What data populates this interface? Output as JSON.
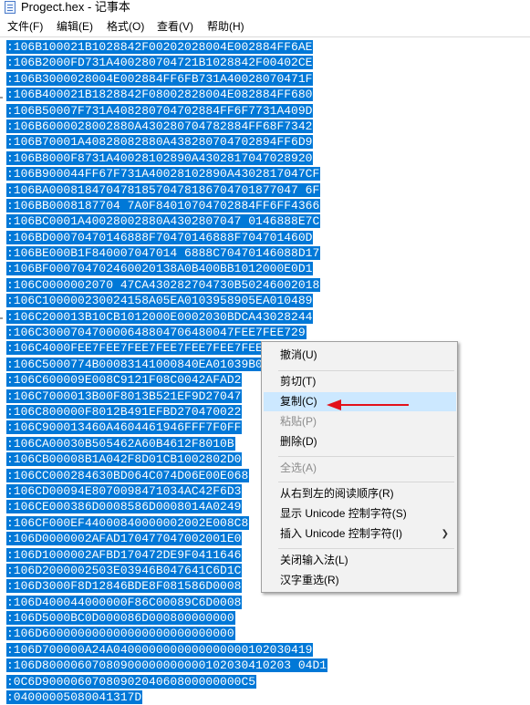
{
  "window": {
    "title": "Progect.hex - 记事本"
  },
  "menubar": [
    {
      "label": "文件(F)"
    },
    {
      "label": "编辑(E)"
    },
    {
      "label": "格式(O)"
    },
    {
      "label": "查看(V)"
    },
    {
      "label": "帮助(H)"
    }
  ],
  "editor": {
    "lines": [
      ":106B100021B1028842F00202028004E002884FF6AE",
      ":106B2000FD731A400280704721B1028842F00402CE",
      ":106B3000028004E002884FF6FB731A40028070471F",
      ":106B400021B1828842F08002828004E082884FF680",
      ":106B50007F731A408280704702884FF6F7731A409D",
      ":106B6000028002880A430280704782884FF68F7342",
      ":106B70001A40828082880A438280704702894FF6D9",
      ":106B8000F8731A40028102890A4302817047028920",
      ":106B900044FF67F731A40028102890A4302817047CF",
      ":106BA00081847047818570478186704701877047 6F",
      ":106BB0008187704 7A0F84010704702884FF6FF4366",
      ":106BC0001A40028002880A4302807047 0146888E7C",
      ":106BD00070470146888F70470146888F704701460D",
      ":106BE000B1F840007047014 6888C70470146088D17",
      ":106BF000704702460020138A0B400BB1012000E0D1",
      ":106C0000002070 47CA430282704730B50246002018",
      ":106C100000230024158A05EA0103958905EA010489",
      ":106C200013B10CB1012000E0002030BDCA43028244",
      ":106C300070470000648804706480047FEE7FEE729",
      ":106C4000FEE7FEE7FEE7FEE7FEE7FEE7FEE7FEE71C",
      ":106C5000774B00083141000840EA01039B0703D04D",
      ":106C600009E008C9121F08C0042AFAD2",
      ":106C7000013B00F8013B521EF9D27047",
      ":106C800000F8012B491EFBD270470022",
      ":106C900013460A4604461946FFF7F0FF",
      ":106CA00030B505462A60B4612F8010B",
      ":106CB00008B1A042F8D01CB1002802D0",
      ":106CC000284630BD064C074D06E00E068",
      ":106CD00094E8070098471034AC42F6D3",
      ":106CE000386D0008586D0008014A0249",
      ":106CF000EF44000840000002002E008C8",
      ":106D0000002AFAD170477047002001E0",
      ":106D1000002AFBD170472DE9F0411646",
      ":106D2000002503E03946B047641C6D1C",
      ":106D3000F8D12846BDE8F081586D0008",
      ":106D400044000000F86C00089C6D0008",
      ":106D5000BC0D000086D000800000000",
      ":106D600000000000000000000000000",
      ":106D700000A24A0400000000000000000102030419",
      ":106D80000607080900000000000102030410203 04D1",
      ":0C6D9000060708090204060800000000C5",
      ":04000005080041317D"
    ]
  },
  "context_menu": {
    "items": [
      {
        "label": "撤消(U)",
        "enabled": true
      },
      {
        "label": "剪切(T)",
        "enabled": true
      },
      {
        "label": "复制(C)",
        "enabled": true,
        "highlighted": true
      },
      {
        "label": "粘贴(P)",
        "enabled": false
      },
      {
        "label": "删除(D)",
        "enabled": true
      },
      {
        "label": "全选(A)",
        "enabled": false
      },
      {
        "label": "从右到左的阅读顺序(R)",
        "enabled": true
      },
      {
        "label": "显示 Unicode 控制字符(S)",
        "enabled": true
      },
      {
        "label": "插入 Unicode 控制字符(I)",
        "enabled": true,
        "submenu": true
      },
      {
        "label": "关闭输入法(L)",
        "enabled": true
      },
      {
        "label": "汉字重选(R)",
        "enabled": true
      }
    ]
  },
  "colors": {
    "selection": "#0078d7",
    "menu_highlight": "#cce8ff",
    "annotation_arrow": "#e3111b"
  }
}
